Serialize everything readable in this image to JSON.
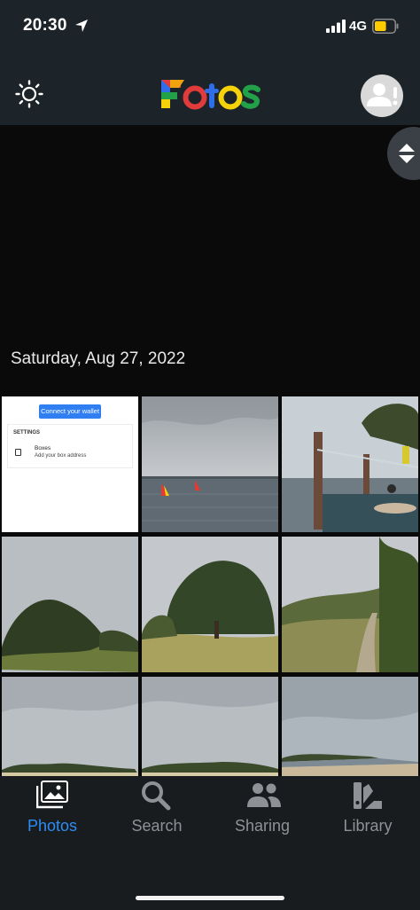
{
  "status_bar": {
    "time": "20:30",
    "network": "4G",
    "battery_level": 0.6,
    "battery_color": "#ffcc00"
  },
  "header": {
    "theme_icon": "sun-icon",
    "logo_text": "Fotos",
    "logo_colors": [
      "#e23b3b",
      "#f1a20f",
      "#2f6ee8",
      "#22a149",
      "#f5d20a"
    ],
    "profile_icon": "person-alert-icon"
  },
  "main": {
    "scroll_icon": "up-down-chevrons-icon",
    "section_date": "Saturday, Aug 27, 2022",
    "thumbnails": [
      {
        "kind": "screenshot",
        "button": "Connect your wallet",
        "settings_title": "SETTINGS",
        "row_label": "Boxes",
        "row_sub": "Add your box address"
      },
      {
        "kind": "photo",
        "scene": "windsurf-sea"
      },
      {
        "kind": "photo",
        "scene": "beach-bar"
      },
      {
        "kind": "photo",
        "scene": "tree-dune-1"
      },
      {
        "kind": "photo",
        "scene": "tree-dune-2"
      },
      {
        "kind": "photo",
        "scene": "path-hill"
      },
      {
        "kind": "photo",
        "scene": "sky-shore-1"
      },
      {
        "kind": "photo",
        "scene": "sky-shore-2"
      },
      {
        "kind": "photo",
        "scene": "beach-shore"
      }
    ]
  },
  "tabbar": {
    "tabs": [
      {
        "label": "Photos",
        "icon": "photos-icon",
        "active": true
      },
      {
        "label": "Search",
        "icon": "search-icon",
        "active": false
      },
      {
        "label": "Sharing",
        "icon": "people-icon",
        "active": false
      },
      {
        "label": "Library",
        "icon": "library-icon",
        "active": false
      }
    ],
    "active_color": "#2d8df2",
    "inactive_color": "#8e9296"
  }
}
